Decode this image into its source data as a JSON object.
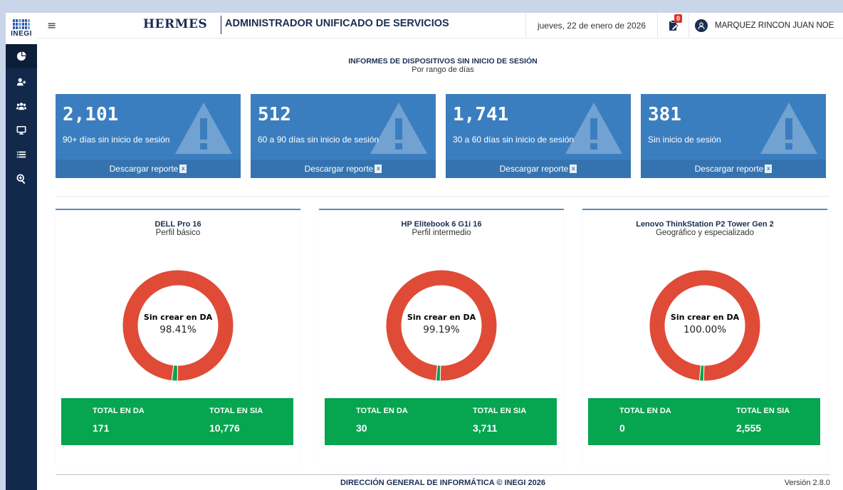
{
  "app": {
    "logo_text": "INEGI",
    "brand": "HERMES",
    "subtitle": "ADMINISTRADOR UNIFICADO DE SERVICIOS"
  },
  "header": {
    "date": "jueves, 22 de enero de 2026",
    "notification_count": "0",
    "user_name": "MARQUEZ RINCON JUAN NOE"
  },
  "sidebar": {
    "items": [
      {
        "icon": "pie-chart-icon",
        "active": true
      },
      {
        "icon": "user-add-icon",
        "active": false
      },
      {
        "icon": "users-group-icon",
        "active": false
      },
      {
        "icon": "monitor-icon",
        "active": false
      },
      {
        "icon": "list-icon",
        "active": false
      },
      {
        "icon": "zoom-in-icon",
        "active": false
      }
    ]
  },
  "page": {
    "title": "INFORMES DE DISPOSITIVOS SIN INICIO DE SESIÓN",
    "subtitle": "Por rango de días"
  },
  "stat_cards": [
    {
      "value": "2,101",
      "label": "90+ días sin inicio de sesión",
      "link": "Descargar reporte"
    },
    {
      "value": "512",
      "label": "60 a 90 días sin inicio de sesión",
      "link": "Descargar reporte"
    },
    {
      "value": "1,741",
      "label": "30 a 60 días sin inicio de sesión",
      "link": "Descargar reporte"
    },
    {
      "value": "381",
      "label": "Sin inicio de sesión",
      "link": "Descargar reporte"
    }
  ],
  "charts": [
    {
      "title": "DELL Pro 16",
      "subtitle": "Perfil básico",
      "center_label": "Sin crear en DA",
      "center_value": "98.41%",
      "totals": {
        "left_label": "TOTAL EN DA",
        "left_value": "171",
        "right_label": "TOTAL EN SIA",
        "right_value": "10,776"
      }
    },
    {
      "title": "HP Elitebook 6 G1i 16",
      "subtitle": "Perfil intermedio",
      "center_label": "Sin crear en DA",
      "center_value": "99.19%",
      "totals": {
        "left_label": "TOTAL EN DA",
        "left_value": "30",
        "right_label": "TOTAL EN SIA",
        "right_value": "3,711"
      }
    },
    {
      "title": "Lenovo ThinkStation P2 Tower Gen 2",
      "subtitle": "Geográfico y especializado",
      "center_label": "Sin crear en DA",
      "center_value": "100.00%",
      "totals": {
        "left_label": "TOTAL EN DA",
        "left_value": "0",
        "right_label": "TOTAL EN SIA",
        "right_value": "2,555"
      }
    }
  ],
  "chart_data": [
    {
      "type": "pie",
      "slices": [
        {
          "label": "Sin crear en DA",
          "value": 98.41
        },
        {
          "label": "",
          "value": 1.59
        }
      ],
      "colors": [
        "#df4b37",
        "#0aa351"
      ]
    },
    {
      "type": "pie",
      "slices": [
        {
          "label": "Sin crear en DA",
          "value": 99.19
        },
        {
          "label": "",
          "value": 0.81
        }
      ],
      "colors": [
        "#df4b37",
        "#0aa351"
      ]
    },
    {
      "type": "pie",
      "slices": [
        {
          "label": "Sin crear en DA",
          "value": 100.0
        },
        {
          "label": "",
          "value": 0.0
        }
      ],
      "colors": [
        "#df4b37",
        "#0aa351"
      ]
    }
  ],
  "colors": {
    "sidebar": "#13294b",
    "stat_card": "#3b7ec0",
    "donut_main": "#df4b37",
    "donut_minor": "#0aa351",
    "totals_bg": "#06a54f",
    "brand": "#1a2e52"
  },
  "footer": {
    "text": "DIRECCIÓN GENERAL DE INFORMÁTICA © INEGI 2026",
    "version": "Versión  2.8.0"
  }
}
